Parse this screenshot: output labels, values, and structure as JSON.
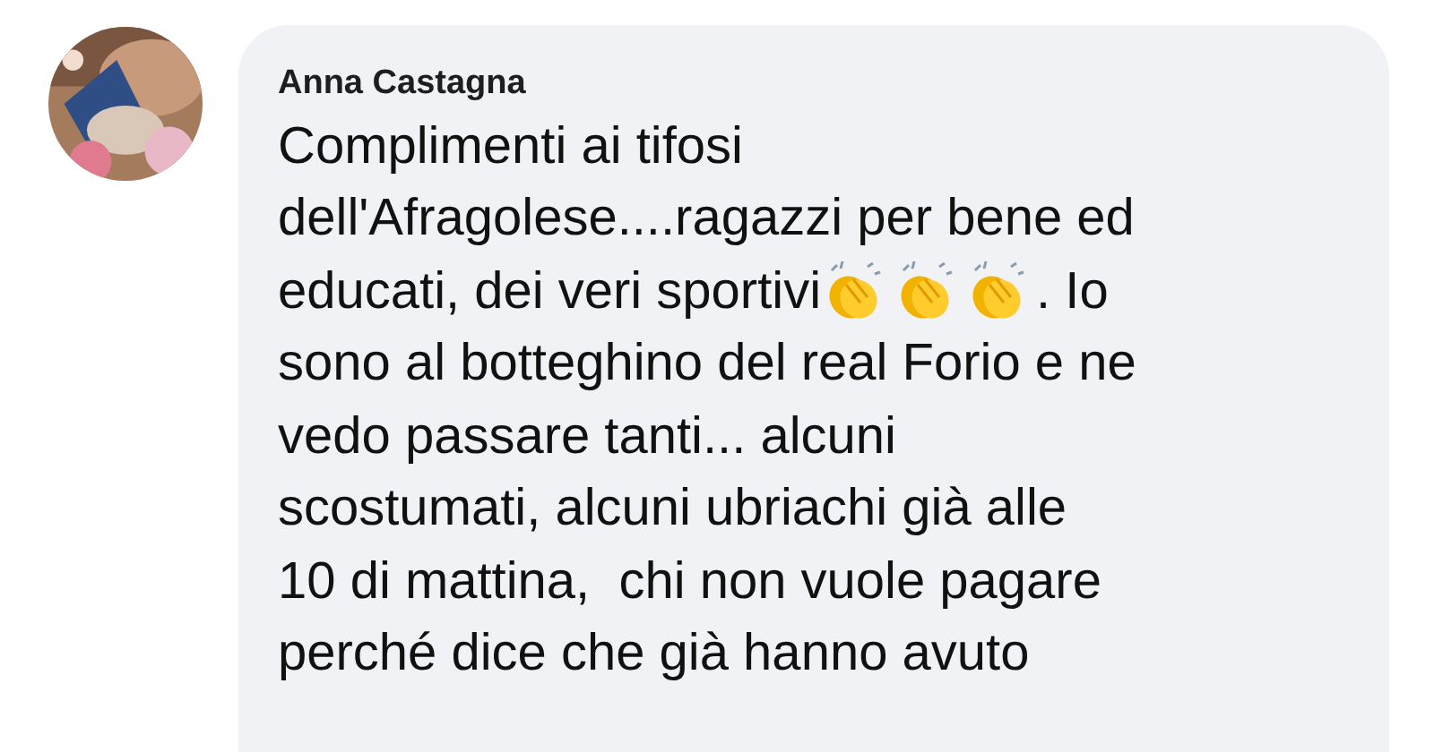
{
  "comment": {
    "author": "Anna Castagna",
    "lines": [
      {
        "parts": [
          {
            "kind": "text",
            "text": "Complimenti ai tifosi"
          }
        ]
      },
      {
        "parts": [
          {
            "kind": "text",
            "text": "dell'Afragolese....ragazzi per bene ed"
          }
        ]
      },
      {
        "parts": [
          {
            "kind": "text",
            "text": "educati, dei veri sportivi"
          },
          {
            "kind": "emoji"
          },
          {
            "kind": "emoji"
          },
          {
            "kind": "emoji"
          },
          {
            "kind": "text",
            "text": ". Io"
          }
        ]
      },
      {
        "parts": [
          {
            "kind": "text",
            "text": "sono al botteghino del real Forio e ne"
          }
        ]
      },
      {
        "parts": [
          {
            "kind": "text",
            "text": "vedo passare tanti... alcuni"
          }
        ]
      },
      {
        "parts": [
          {
            "kind": "text",
            "text": "scostumati, alcuni ubriachi già alle"
          }
        ]
      },
      {
        "parts": [
          {
            "kind": "text",
            "text": "10 di mattina,  chi non vuole pagare"
          }
        ]
      },
      {
        "parts": [
          {
            "kind": "text",
            "text": "perché dice che già hanno avuto"
          }
        ]
      }
    ]
  }
}
